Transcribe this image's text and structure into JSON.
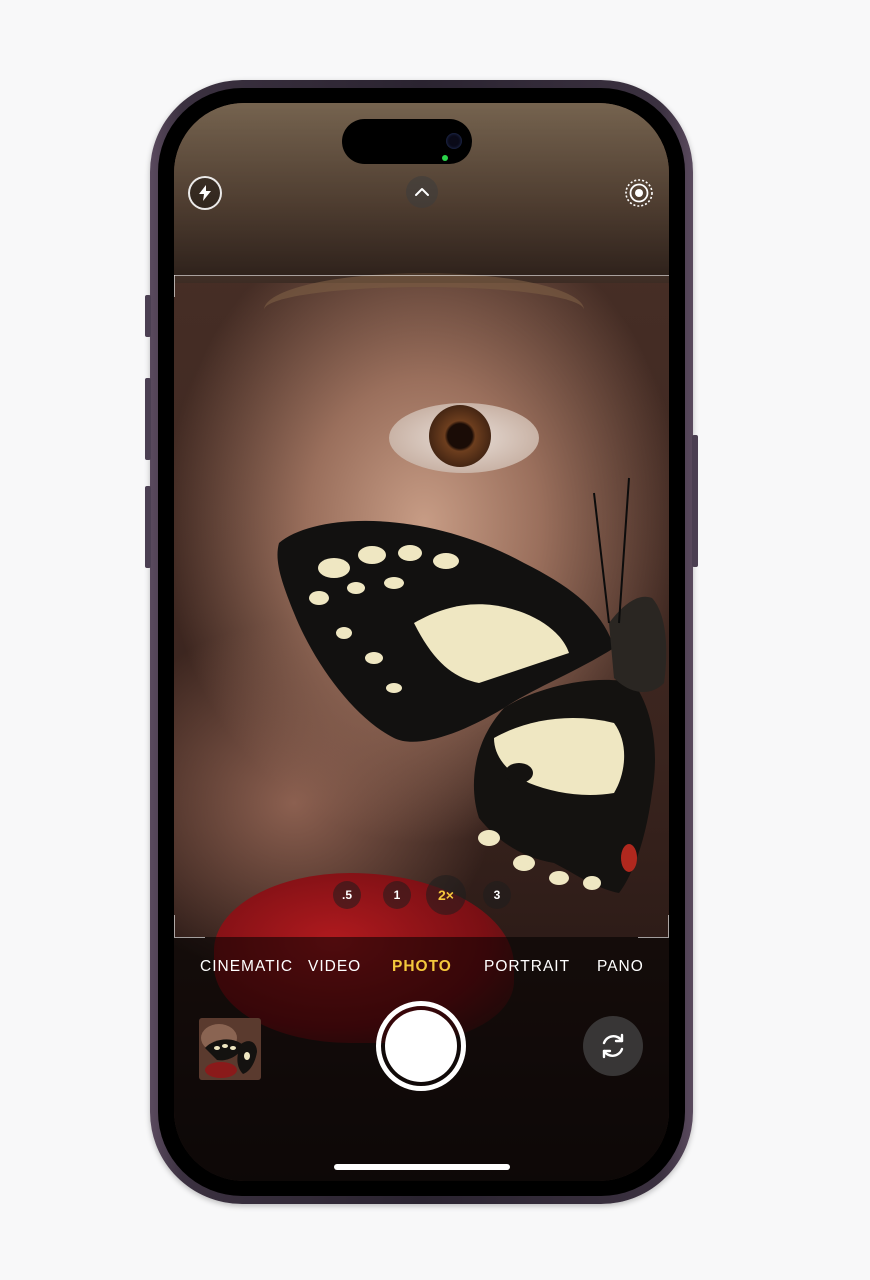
{
  "camera": {
    "top_controls": {
      "flash_icon": "flash-bolt-icon",
      "expand_icon": "chevron-up-icon",
      "live_icon": "live-photo-icon"
    },
    "zoom_levels": [
      {
        "label": ".5",
        "active": false
      },
      {
        "label": "1",
        "active": false
      },
      {
        "label": "2×",
        "active": true
      },
      {
        "label": "3",
        "active": false
      }
    ],
    "modes": [
      {
        "label": "CINEMATIC",
        "active": false
      },
      {
        "label": "VIDEO",
        "active": false
      },
      {
        "label": "PHOTO",
        "active": true
      },
      {
        "label": "PORTRAIT",
        "active": false
      },
      {
        "label": "PANO",
        "active": false
      }
    ],
    "bottom_controls": {
      "shutter_icon": "shutter-button",
      "flip_icon": "camera-flip-icon",
      "thumbnail_icon": "last-photo-thumbnail"
    },
    "colors": {
      "accent_yellow": "#f4c83c",
      "phone_frame": "#3b3140",
      "background": "#f8f8f9"
    }
  }
}
